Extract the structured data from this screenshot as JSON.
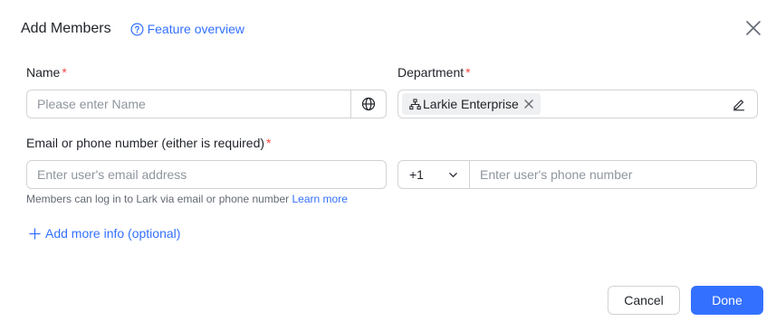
{
  "dialog": {
    "title": "Add Members",
    "feature_overview": "Feature overview",
    "close_icon": "close-icon"
  },
  "fields": {
    "name": {
      "label": "Name",
      "required": "*",
      "placeholder": "Please enter Name",
      "value": ""
    },
    "department": {
      "label": "Department",
      "required": "*",
      "tag": "Larkie Enterprise"
    },
    "contact": {
      "label": "Email or phone number (either is required)",
      "required": "*",
      "email_placeholder": "Enter user's email address",
      "country_code": "+1",
      "phone_placeholder": "Enter user's phone number",
      "hint": "Members can log in to Lark via email or phone number",
      "hint_link": "Learn more"
    }
  },
  "add_more": "Add more info (optional)",
  "actions": {
    "cancel": "Cancel",
    "done": "Done"
  },
  "colors": {
    "accent": "#3370ff",
    "required": "#f54a45",
    "border": "#d0d3d6",
    "placeholder": "#8f959e"
  }
}
